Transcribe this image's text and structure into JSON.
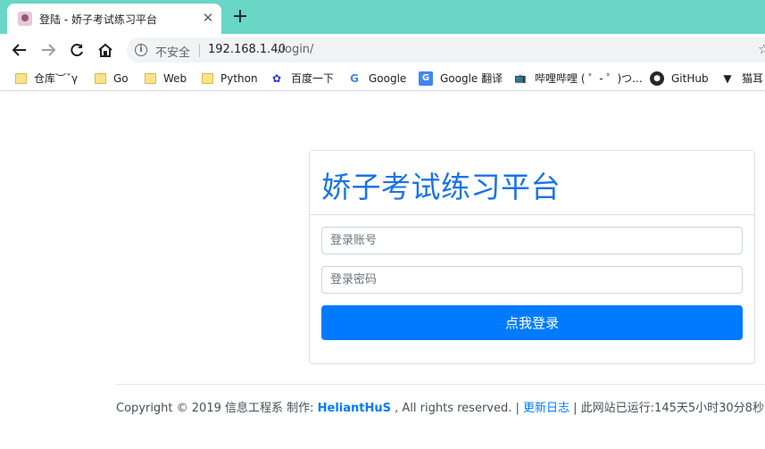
{
  "tab": {
    "title": "登陆 - 娇子考试练习平台",
    "close_glyph": "✕",
    "new_tab_glyph": "+"
  },
  "address_bar": {
    "security_text": "不安全",
    "url_host": "192.168.1.40",
    "url_path": "/login/"
  },
  "bookmarks": [
    {
      "label": "仓库︶ˇγ",
      "icon": "folder-icon"
    },
    {
      "label": "Go",
      "icon": "folder-icon"
    },
    {
      "label": "Web",
      "icon": "folder-icon"
    },
    {
      "label": "Python",
      "icon": "folder-icon"
    },
    {
      "label": "百度一下",
      "icon": "baidu-paw-icon"
    },
    {
      "label": "Google",
      "icon": "google-g-icon"
    },
    {
      "label": "Google 翻译",
      "icon": "google-translate-icon"
    },
    {
      "label": "哔哩哔哩 ( ゜- ゜)つ...",
      "icon": "bilibili-tv-icon"
    },
    {
      "label": "GitHub",
      "icon": "github-octocat-icon"
    },
    {
      "label": "猫耳",
      "icon": "cat-icon"
    }
  ],
  "login": {
    "title": "娇子考试练习平台",
    "username_placeholder": "登录账号",
    "password_placeholder": "登录密码",
    "submit_label": "点我登录"
  },
  "footer": {
    "prefix": "Copyright © 2019 信息工程系 制作: ",
    "author": "HeliantHuS",
    "rights": " , All rights reserved. | ",
    "changelog_link": "更新日志",
    "uptime": " | 此网站已运行:145天5小时30分8秒"
  },
  "colors": {
    "tab_strip": "#6ad6c6",
    "accent": "#007bff",
    "title_blue": "#1a73e8"
  }
}
